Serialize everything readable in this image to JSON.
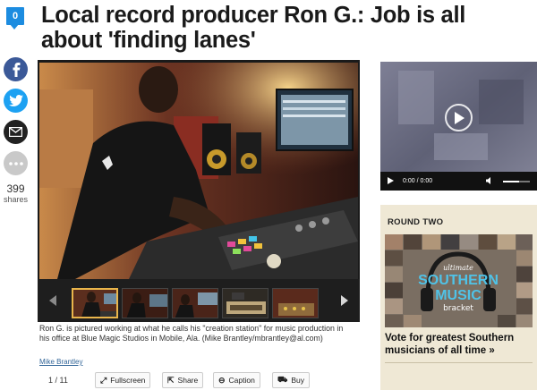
{
  "comments": {
    "count": "0"
  },
  "article": {
    "headline": "Local record producer Ron G.: Job is all about 'finding lanes'"
  },
  "share": {
    "count": "399",
    "count_label": "shares",
    "networks": [
      "facebook-icon",
      "twitter-icon",
      "email-icon",
      "more-icon"
    ],
    "colors": {
      "facebook": "#3b5998",
      "twitter": "#1da1f2",
      "email": "#222222",
      "more": "#c9c9c9"
    }
  },
  "gallery": {
    "caption": "Ron G. is pictured working at what he calls his \"creation station\" for music production in his office at Blue Magic Studios in Mobile, Ala. (Mike Brantley/mbrantley@al.com)",
    "credit": "Mike Brantley",
    "counter": "1 / 11",
    "buttons": {
      "fullscreen": "Fullscreen",
      "share": "Share",
      "caption": "Caption",
      "buy": "Buy"
    },
    "accent": "#e9b54b"
  },
  "video": {
    "current_time": "0:00",
    "separator": "/",
    "duration": "0:00"
  },
  "promo": {
    "title": "ROUND TWO",
    "art_line1": "ultimate",
    "art_line2": "SOUTHERN",
    "art_line3": "MUSIC",
    "art_line4": "bracket",
    "headline": "Vote for greatest Southern musicians of all time »"
  }
}
